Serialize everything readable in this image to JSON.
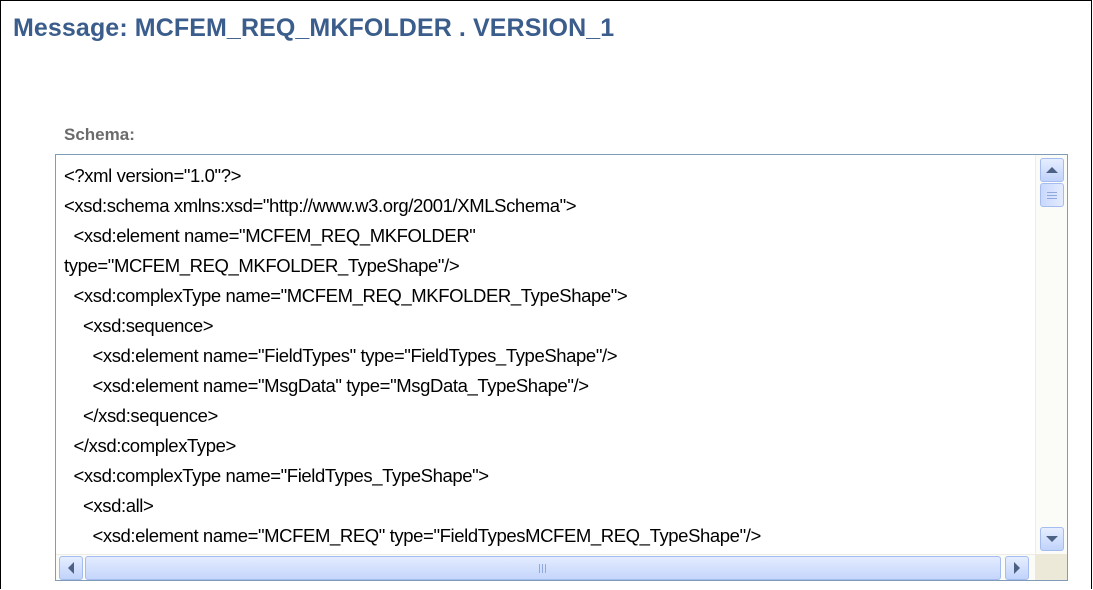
{
  "page": {
    "title": "Message: MCFEM_REQ_MKFOLDER . VERSION_1",
    "title_color": "#3b5d8c"
  },
  "schema": {
    "label": "Schema:",
    "lines": [
      "<?xml version=\"1.0\"?>",
      "<xsd:schema xmlns:xsd=\"http://www.w3.org/2001/XMLSchema\">",
      "  <xsd:element name=\"MCFEM_REQ_MKFOLDER\"",
      "type=\"MCFEM_REQ_MKFOLDER_TypeShape\"/>",
      "  <xsd:complexType name=\"MCFEM_REQ_MKFOLDER_TypeShape\">",
      "    <xsd:sequence>",
      "      <xsd:element name=\"FieldTypes\" type=\"FieldTypes_TypeShape\"/>",
      "      <xsd:element name=\"MsgData\" type=\"MsgData_TypeShape\"/>",
      "    </xsd:sequence>",
      "  </xsd:complexType>",
      "  <xsd:complexType name=\"FieldTypes_TypeShape\">",
      "    <xsd:all>",
      "      <xsd:element name=\"MCFEM_REQ\" type=\"FieldTypesMCFEM_REQ_TypeShape\"/>"
    ]
  },
  "scrollbars": {
    "vertical": {
      "up_icon": "chevron-up-icon",
      "down_icon": "chevron-down-icon"
    },
    "horizontal": {
      "left_icon": "chevron-left-icon",
      "right_icon": "chevron-right-icon"
    }
  }
}
